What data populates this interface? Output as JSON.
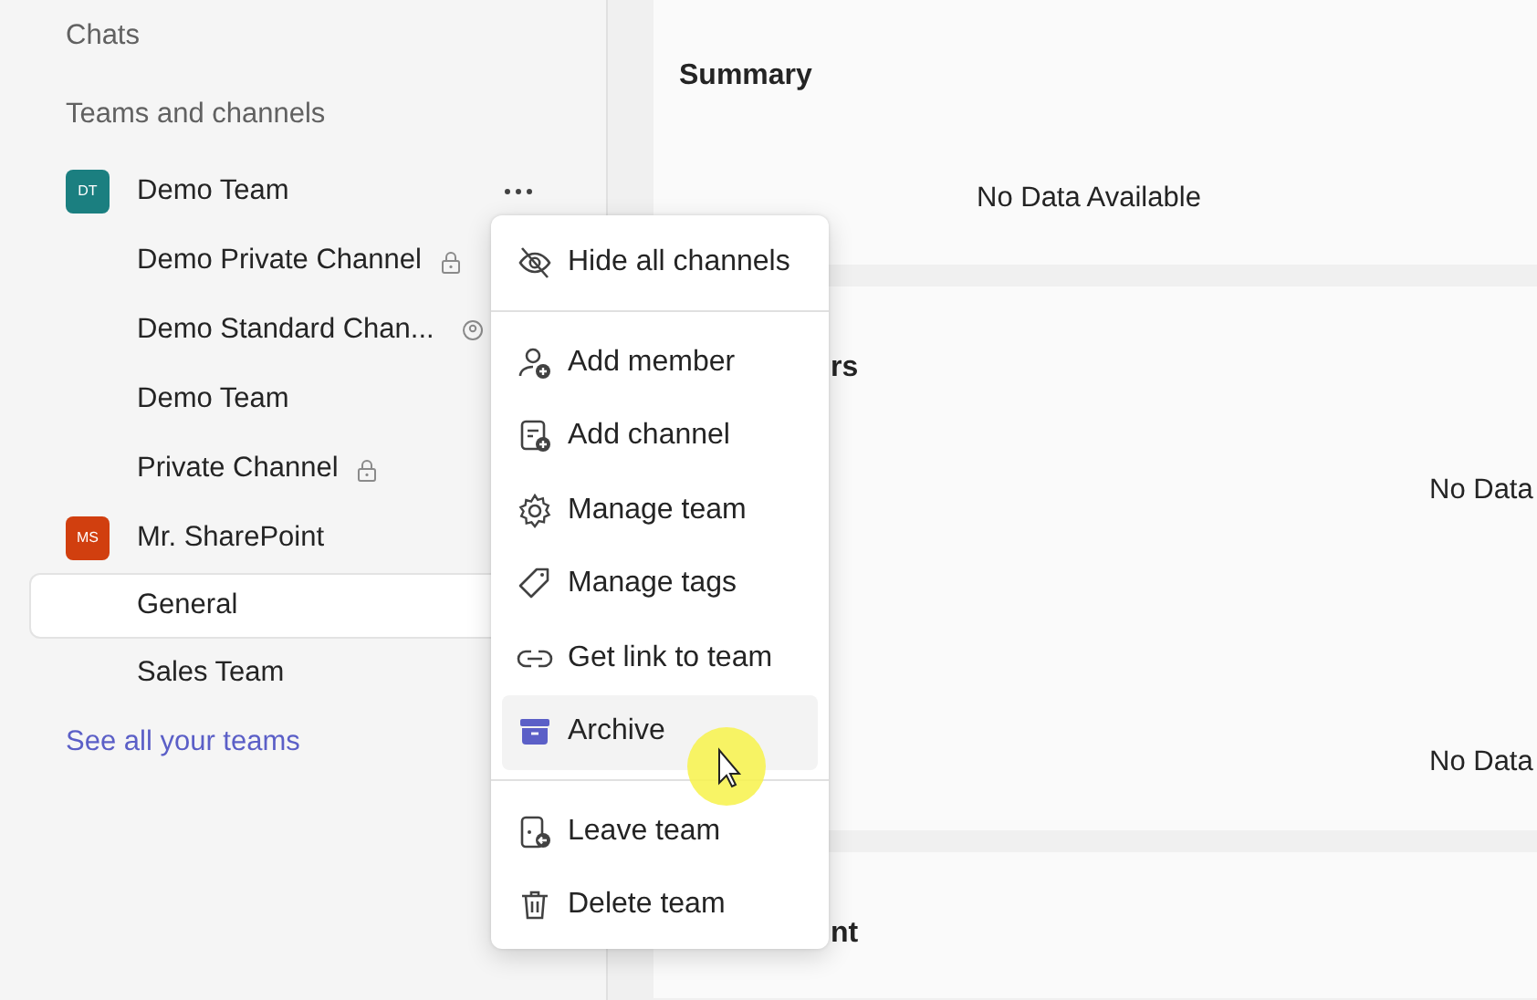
{
  "sidebar": {
    "chats_label": "Chats",
    "section_title": "Teams and channels",
    "teams": [
      {
        "initials": "DT",
        "name": "Demo Team",
        "color": "#1b7f80",
        "more": true,
        "channels": [
          {
            "name": "Demo Private Channel",
            "kind": "private",
            "selected": false
          },
          {
            "name": "Demo Standard Chan...",
            "kind": "shared",
            "selected": false
          },
          {
            "name": "Demo Team",
            "kind": "standard",
            "selected": false
          },
          {
            "name": "Private Channel",
            "kind": "private",
            "selected": false
          }
        ]
      },
      {
        "initials": "MS",
        "name": "Mr. SharePoint",
        "color": "#d13f0f",
        "more": false,
        "channels": [
          {
            "name": "General",
            "kind": "standard",
            "selected": true
          },
          {
            "name": "Sales Team",
            "kind": "standard",
            "selected": false
          }
        ]
      }
    ],
    "see_all_link": "See all your teams"
  },
  "context_menu": {
    "groups": [
      [
        {
          "label": "Hide all channels",
          "selected": false
        }
      ],
      [
        {
          "label": "Add member",
          "selected": false
        },
        {
          "label": "Add channel",
          "selected": false
        },
        {
          "label": "Manage team",
          "selected": false
        },
        {
          "label": "Manage tags",
          "selected": false
        },
        {
          "label": "Get link to team",
          "selected": false
        },
        {
          "label": "Archive",
          "selected": true
        }
      ],
      [
        {
          "label": "Leave team",
          "selected": false
        },
        {
          "label": "Delete team",
          "selected": false
        }
      ]
    ]
  },
  "cards": [
    {
      "title": "Summary",
      "entries": [
        "No Data Available"
      ]
    },
    {
      "title": "rs",
      "entries": [
        "No Data",
        "No Data"
      ]
    },
    {
      "title": "nt"
    }
  ]
}
